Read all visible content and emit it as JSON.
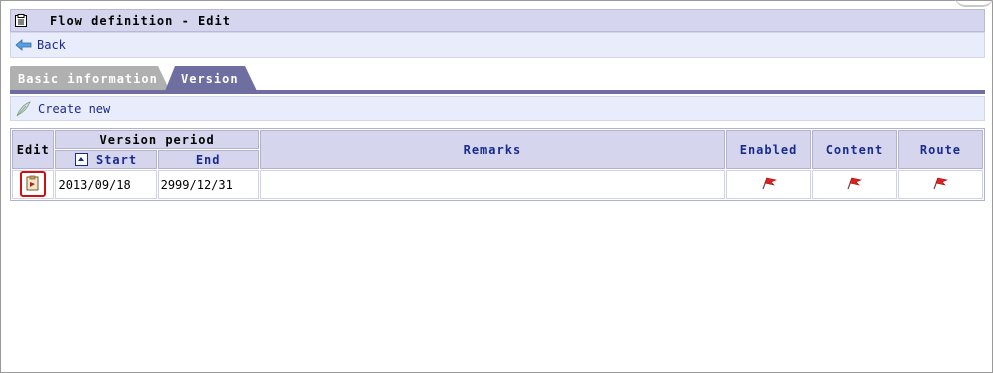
{
  "window": {
    "title": "Flow definition - Edit"
  },
  "nav": {
    "back_label": "Back"
  },
  "tabs": [
    {
      "label": "Basic information",
      "active": false
    },
    {
      "label": "Version",
      "active": true
    }
  ],
  "toolbar": {
    "create_label": "Create new"
  },
  "table": {
    "headers": {
      "edit": "Edit",
      "version_period": "Version period",
      "start": "Start",
      "end": "End",
      "remarks": "Remarks",
      "enabled": "Enabled",
      "content": "Content",
      "route": "Route"
    },
    "rows": [
      {
        "start": "2013/09/18",
        "end": "2999/12/31",
        "remarks": "",
        "enabled_icon": "red-flag-icon",
        "content_icon": "red-flag-icon",
        "route_icon": "red-flag-icon"
      }
    ]
  },
  "colors": {
    "header_bg": "#d5d6ee",
    "accent": "#1a2b8c",
    "tab_active": "#6e6ea0",
    "highlight": "#cc1111"
  }
}
